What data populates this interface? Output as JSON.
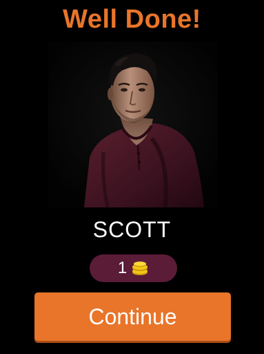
{
  "header": {
    "title": "Well Done!"
  },
  "question": {
    "image_alt": "Photo of a dark-haired young man in a maroon henley shirt on a black background"
  },
  "result": {
    "answer": "SCOTT",
    "reward_amount": "1",
    "reward_icon": "coin-stack-icon"
  },
  "actions": {
    "continue_label": "Continue"
  },
  "colors": {
    "accent": "#e8752a",
    "reward_pill": "#5b1c38",
    "coin": "#f5c518",
    "background": "#000000"
  }
}
